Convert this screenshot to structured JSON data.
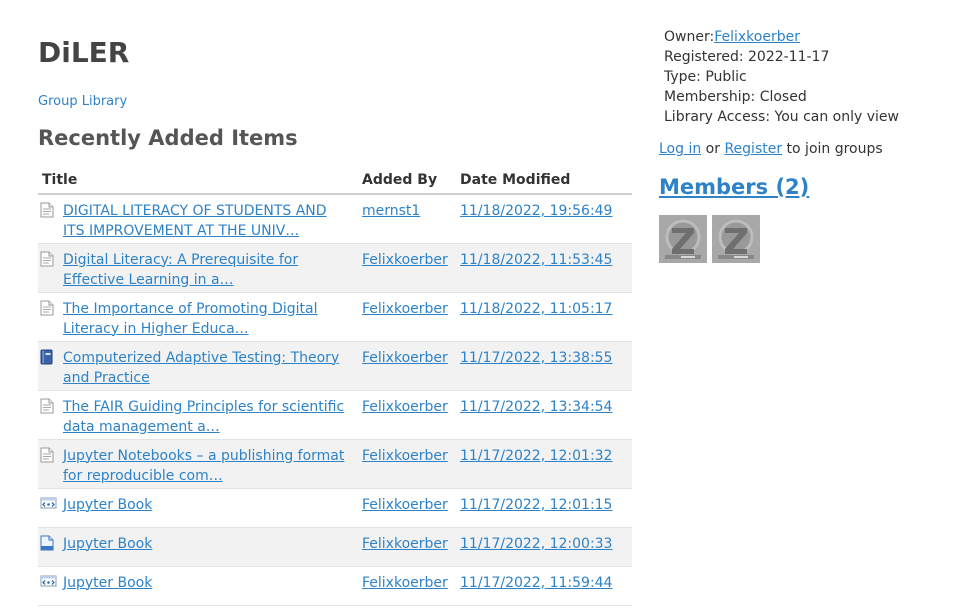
{
  "group": {
    "title": "DiLER",
    "library_link": "Group Library"
  },
  "recent": {
    "heading": "Recently Added Items",
    "columns": {
      "title": "Title",
      "added_by": "Added By",
      "date_modified": "Date Modified"
    },
    "items": [
      {
        "icon": "document-icon",
        "title": "DIGITAL LITERACY OF STUDENTS AND ITS IMPROVEMENT AT THE UNIV…",
        "added_by": "mernst1",
        "date": "11/18/2022, 19:56:49"
      },
      {
        "icon": "document-icon",
        "title": "Digital Literacy: A Prerequisite for Effective Learning in a…",
        "added_by": "Felixkoerber",
        "date": "11/18/2022, 11:53:45"
      },
      {
        "icon": "document-icon",
        "title": "The Importance of Promoting Digital Literacy in Higher Educa…",
        "added_by": "Felixkoerber",
        "date": "11/18/2022, 11:05:17"
      },
      {
        "icon": "book-icon",
        "title": "Computerized Adaptive Testing: Theory and Practice",
        "added_by": "Felixkoerber",
        "date": "11/17/2022, 13:38:55"
      },
      {
        "icon": "document-icon",
        "title": "The FAIR Guiding Principles for scientific data management a…",
        "added_by": "Felixkoerber",
        "date": "11/17/2022, 13:34:54"
      },
      {
        "icon": "document-icon",
        "title": "Jupyter Notebooks – a publishing format for reproducible com…",
        "added_by": "Felixkoerber",
        "date": "11/17/2022, 12:01:32"
      },
      {
        "icon": "webpage-icon",
        "title": "Jupyter Book",
        "added_by": "Felixkoerber",
        "date": "11/17/2022, 12:01:15"
      },
      {
        "icon": "blue-document-icon",
        "title": "Jupyter Book",
        "added_by": "Felixkoerber",
        "date": "11/17/2022, 12:00:33"
      },
      {
        "icon": "webpage-icon",
        "title": "Jupyter Book",
        "added_by": "Felixkoerber",
        "date": "11/17/2022, 11:59:44"
      }
    ]
  },
  "sidebar": {
    "owner_label": "Owner:",
    "owner_name": "Felixkoerber",
    "registered": "Registered: 2022-11-17",
    "type": "Type: Public",
    "membership": "Membership: Closed",
    "library_access": "Library Access: You can only view",
    "login_link": "Log in",
    "or_text": " or ",
    "register_link": "Register",
    "join_text": " to join groups",
    "members_heading": "Members (2)",
    "member_count": 2
  },
  "colors": {
    "link": "#2e82c7",
    "row_alt": "#f2f2f2",
    "header_border": "#d0d0d0"
  }
}
